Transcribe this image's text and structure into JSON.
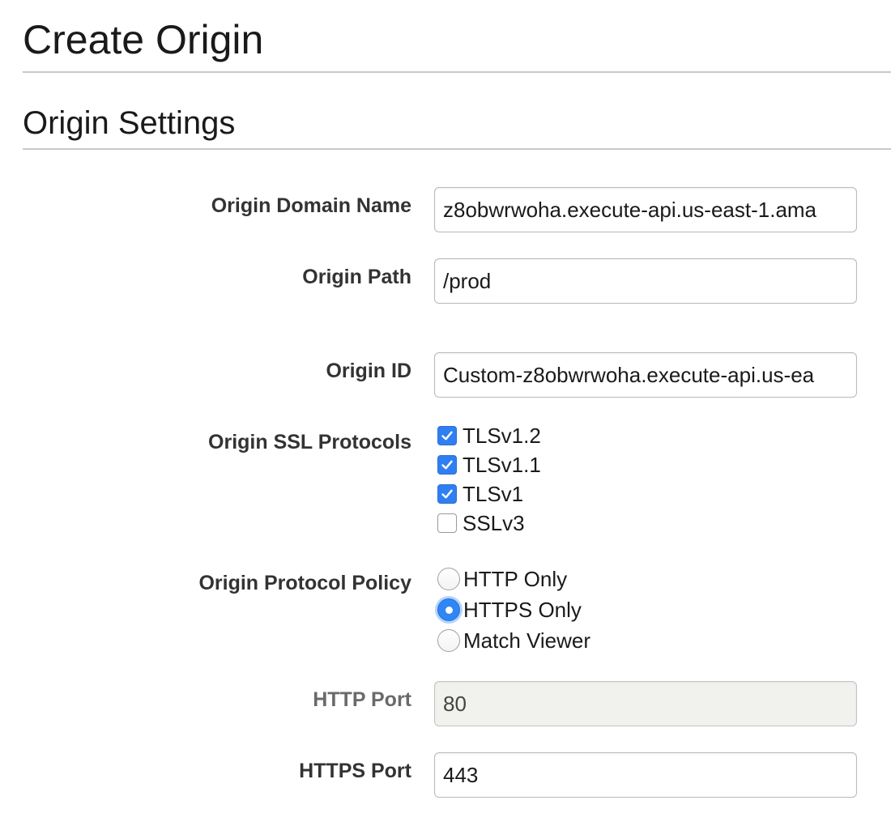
{
  "page": {
    "title": "Create Origin",
    "section_title": "Origin Settings"
  },
  "fields": {
    "origin_domain_name": {
      "label": "Origin Domain Name",
      "value": "z8obwrwoha.execute-api.us-east-1.ama"
    },
    "origin_path": {
      "label": "Origin Path",
      "value": "/prod"
    },
    "origin_id": {
      "label": "Origin ID",
      "value": "Custom-z8obwrwoha.execute-api.us-ea"
    },
    "ssl_protocols": {
      "label": "Origin SSL Protocols",
      "options": [
        {
          "label": "TLSv1.2",
          "checked": true
        },
        {
          "label": "TLSv1.1",
          "checked": true
        },
        {
          "label": "TLSv1",
          "checked": true
        },
        {
          "label": "SSLv3",
          "checked": false
        }
      ]
    },
    "protocol_policy": {
      "label": "Origin Protocol Policy",
      "options": [
        {
          "label": "HTTP Only",
          "selected": false
        },
        {
          "label": "HTTPS Only",
          "selected": true
        },
        {
          "label": "Match Viewer",
          "selected": false
        }
      ]
    },
    "http_port": {
      "label": "HTTP Port",
      "value": "80",
      "disabled": true
    },
    "https_port": {
      "label": "HTTPS Port",
      "value": "443"
    }
  },
  "colors": {
    "accent": "#2f7ff2",
    "rule": "#c9c9c9",
    "disabled_input_bg": "#f1f1ee"
  }
}
